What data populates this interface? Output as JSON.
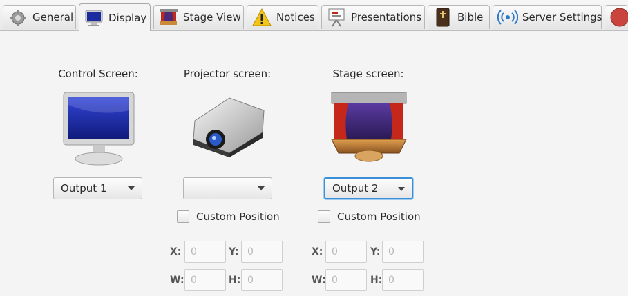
{
  "tabs": [
    {
      "label": "General",
      "icon": "gear-icon"
    },
    {
      "label": "Display",
      "icon": "monitor-icon",
      "active": true
    },
    {
      "label": "Stage View",
      "icon": "stage-icon"
    },
    {
      "label": "Notices",
      "icon": "warning-icon"
    },
    {
      "label": "Presentations",
      "icon": "presentation-board-icon"
    },
    {
      "label": "Bible",
      "icon": "bible-icon"
    },
    {
      "label": "Server Settings",
      "icon": "wireless-icon"
    },
    {
      "label": "",
      "icon": "red-circle-icon"
    }
  ],
  "control": {
    "label": "Control Screen:",
    "output": "Output 1"
  },
  "projector": {
    "label": "Projector screen:",
    "output": "",
    "custom_position_label": "Custom Position",
    "x_label": "X:",
    "y_label": "Y:",
    "w_label": "W:",
    "h_label": "H:",
    "x_value": "0",
    "y_value": "0",
    "w_value": "0",
    "h_value": "0"
  },
  "stage": {
    "label": "Stage screen:",
    "output": "Output 2",
    "custom_position_label": "Custom Position",
    "x_label": "X:",
    "y_label": "Y:",
    "w_label": "W:",
    "h_label": "H:",
    "x_value": "0",
    "y_value": "0",
    "w_value": "0",
    "h_value": "0"
  },
  "colors": {
    "accent_focus": "#3a8fd6",
    "background": "#f4f4f4"
  }
}
